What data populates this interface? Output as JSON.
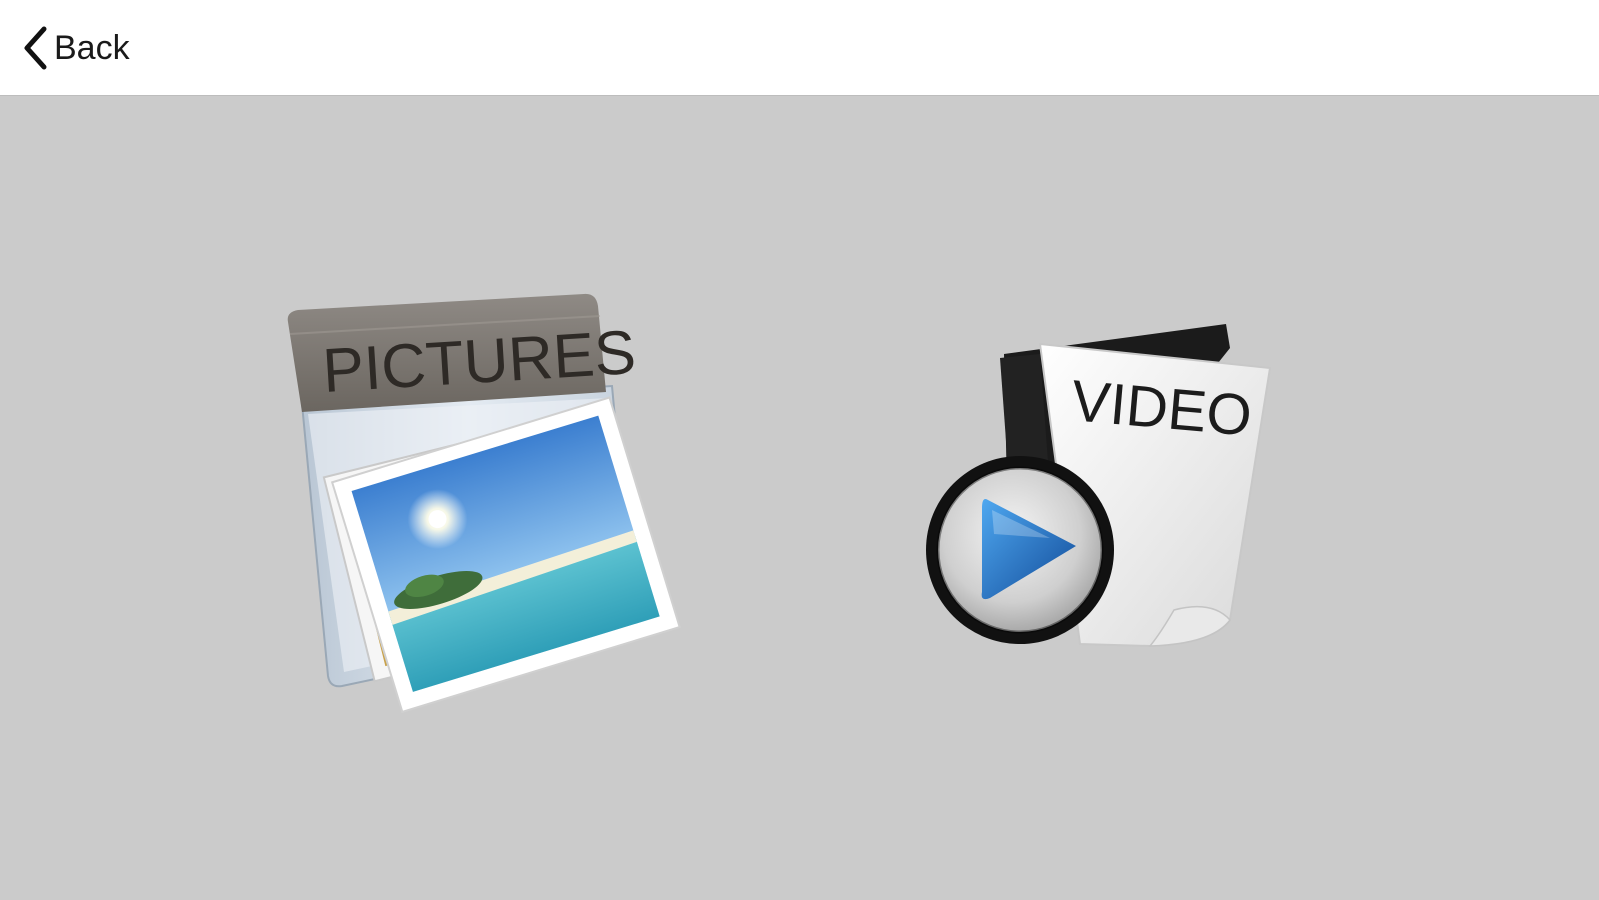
{
  "navbar": {
    "back_label": "Back",
    "back_icon": "chevron-left-icon"
  },
  "tiles": [
    {
      "id": "pictures",
      "label": "PICTURES",
      "icon": "pictures-folder-icon"
    },
    {
      "id": "video",
      "label": "VIDEO",
      "icon": "video-file-icon"
    }
  ],
  "colors": {
    "navbar_background": "#ffffff",
    "content_background": "#cbcbcb",
    "play_button_blue": "#1f6fc4"
  }
}
